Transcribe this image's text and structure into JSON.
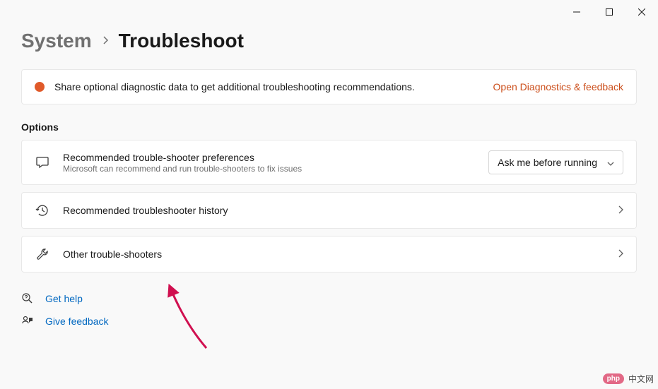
{
  "breadcrumb": {
    "parent": "System",
    "current": "Troubleshoot"
  },
  "banner": {
    "text": "Share optional diagnostic data to get additional troubleshooting recommendations.",
    "link": "Open Diagnostics & feedback"
  },
  "section_title": "Options",
  "preferences": {
    "title": "Recommended trouble-shooter preferences",
    "subtitle": "Microsoft can recommend and run trouble-shooters to fix issues",
    "dropdown_value": "Ask me before running"
  },
  "history": {
    "title": "Recommended troubleshooter history"
  },
  "other": {
    "title": "Other trouble-shooters"
  },
  "footer": {
    "help": "Get help",
    "feedback": "Give feedback"
  },
  "watermark": {
    "bubble": "php",
    "text": "中文网"
  }
}
